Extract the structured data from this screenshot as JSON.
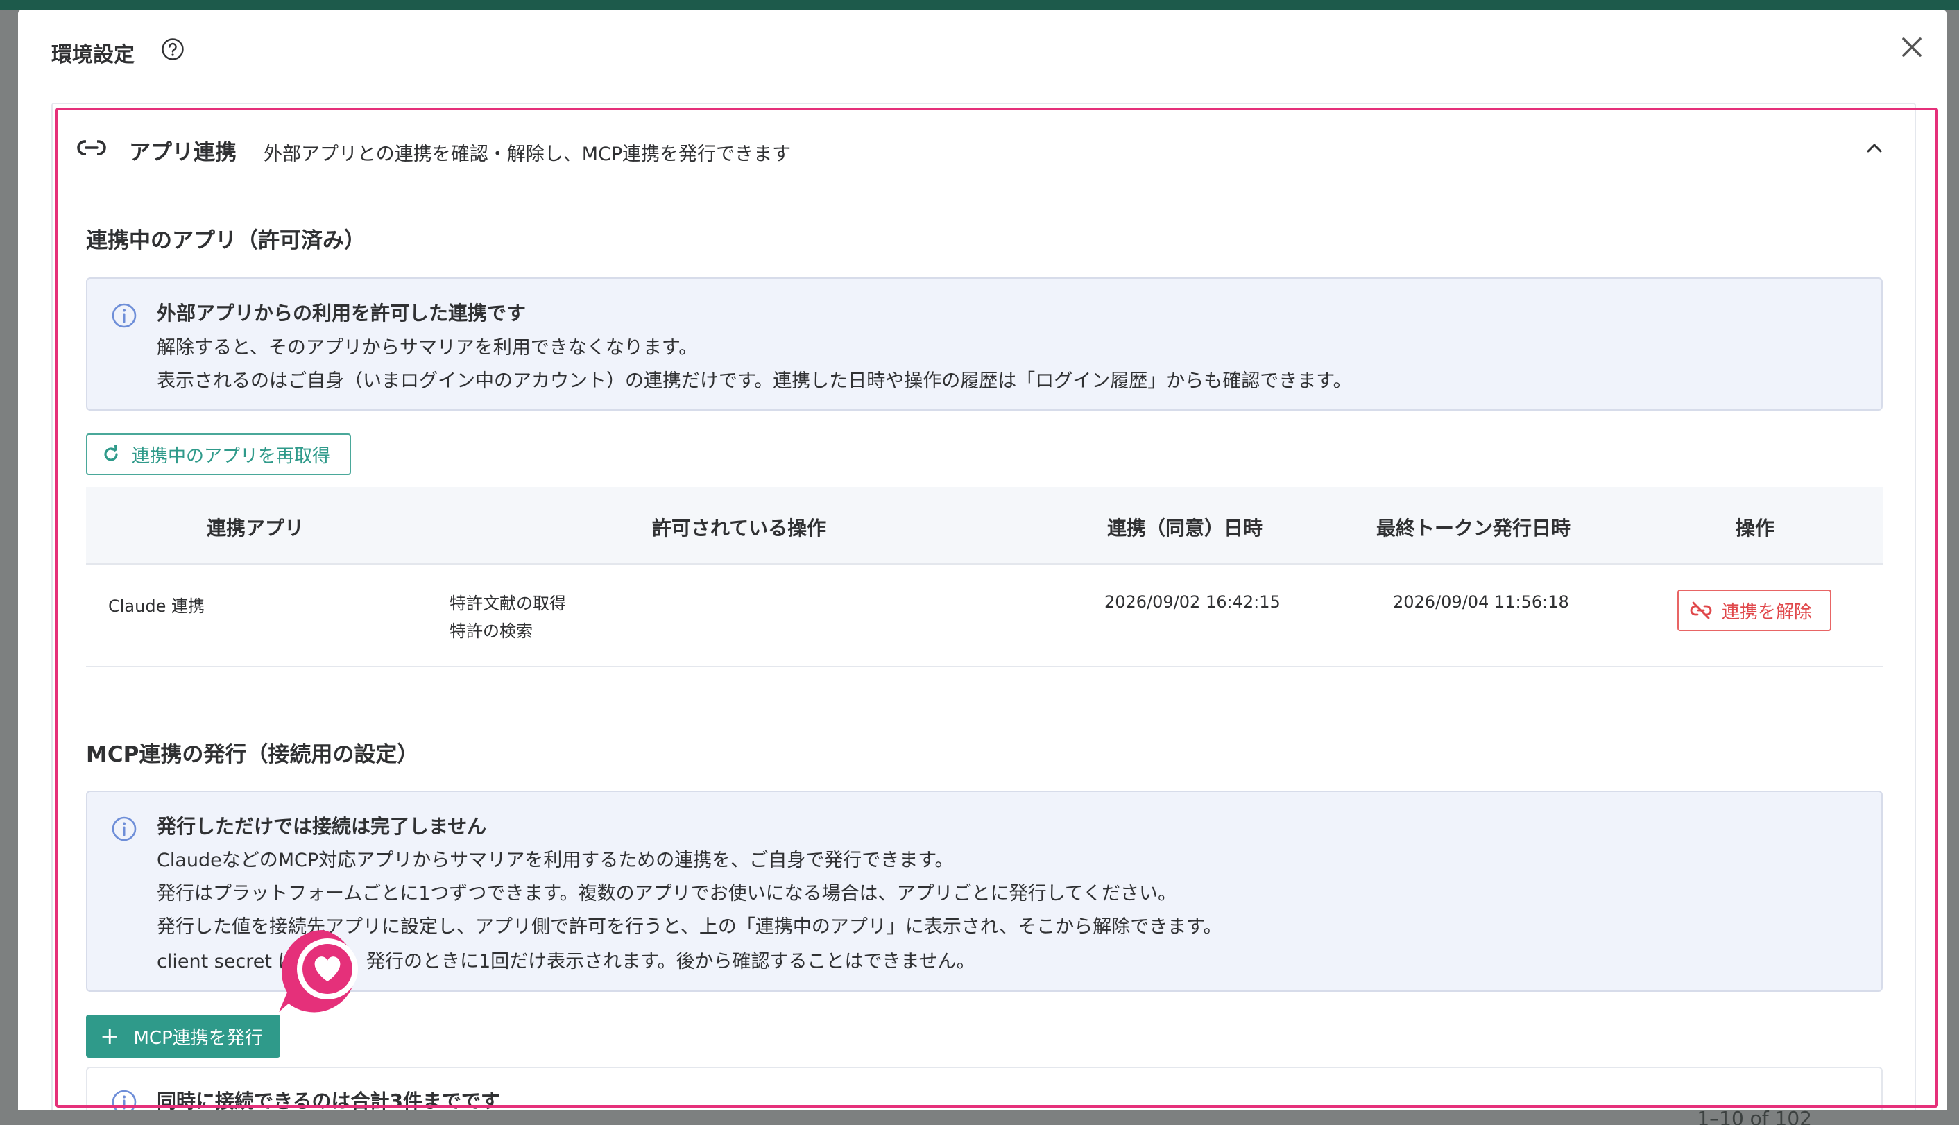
{
  "background": {
    "pagination_text": "1–10 of 102",
    "prev_chevron": "‹",
    "next_chevron": "›"
  },
  "modal": {
    "title": "環境設定",
    "help_icon": "question-circle-icon",
    "close_icon": "close-icon"
  },
  "section": {
    "icon": "link-icon",
    "title": "アプリ連携",
    "description": "外部アプリとの連携を確認・解除し、MCP連携を発行できます",
    "collapse_icon": "chevron-up-icon"
  },
  "connected_apps": {
    "title": "連携中のアプリ（許可済み）",
    "info": {
      "title": "外部アプリからの利用を許可した連携です",
      "lines": [
        "解除すると、そのアプリからサマリアを利用できなくなります。",
        "表示されるのはご自身（いまログイン中のアカウント）の連携だけです。連携した日時や操作の履歴は「ログイン履歴」からも確認できます。"
      ]
    },
    "refresh_button": "連携中のアプリを再取得",
    "table": {
      "headers": [
        "連携アプリ",
        "許可されている操作",
        "連携（同意）日時",
        "最終トークン発行日時",
        "操作"
      ],
      "rows": [
        {
          "app": "Claude 連携",
          "operations": [
            "特許文献の取得",
            "特許の検索"
          ],
          "consented_at": "2026/09/02 16:42:15",
          "last_token_at": "2026/09/04 11:56:18",
          "action": "連携を解除"
        }
      ]
    }
  },
  "mcp": {
    "title": "MCP連携の発行（接続用の設定）",
    "info": {
      "title": "発行しただけでは接続は完了しません",
      "lines": [
        "ClaudeなどのMCP対応アプリからサマリアを利用するための連携を、ご自身で発行できます。",
        "発行はプラットフォームごとに1つずつできます。複数のアプリでお使いになる場合は、アプリごとに発行してください。",
        "発行した値を接続先アプリに設定し、アプリ側で許可を行うと、上の「連携中のアプリ」に表示され、そこから解除できます。",
        "client secret は",
        "発行のときに1回だけ表示されます。後から確認することはできません。"
      ]
    },
    "issue_button": "MCP連携を発行",
    "limit_info_title": "同時に接続できるのは合計3件までです"
  },
  "colors": {
    "accent": "#2f9a8a",
    "danger": "#e0474a",
    "highlight": "#e5307a",
    "info_bg": "#f0f3fb"
  }
}
